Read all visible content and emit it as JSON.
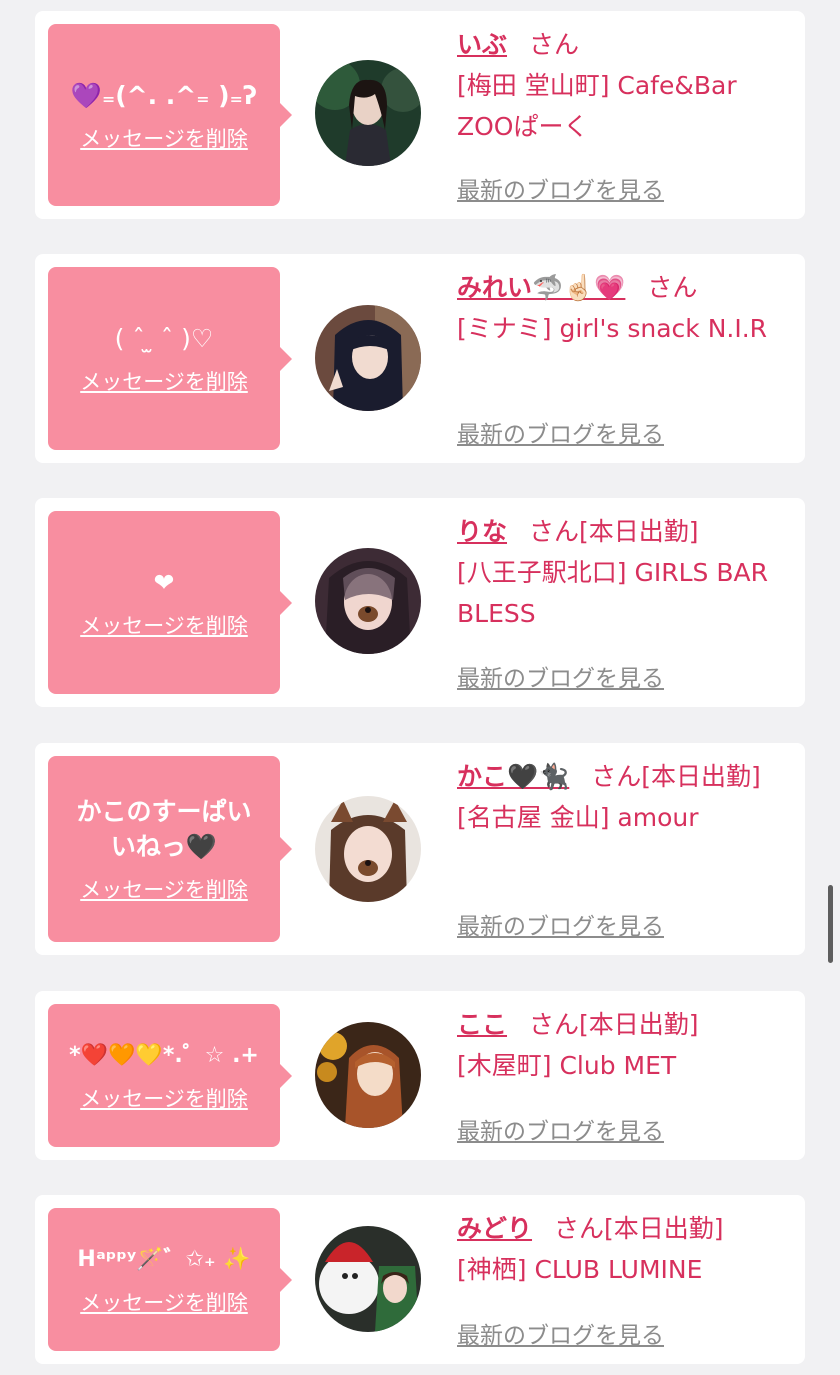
{
  "theme": {
    "bubble_color": "#f88ea0",
    "accent": "#d7305d",
    "link_gray": "#8c8c8c"
  },
  "cards": [
    {
      "message": "💜₌(^. .^₌ )₌ʔ",
      "delete_label": "メッセージを削除",
      "name": "いぶ",
      "suffix": "さん",
      "shop": "[梅田 堂山町] Cafe&Bar ZOOぱーく",
      "blog_label": "最新のブログを見る",
      "avatar_icon": "profile-photo"
    },
    {
      "message": "( ˆ ̫ ˆ )♡",
      "delete_label": "メッセージを削除",
      "name": "みれい🦈☝🏻💗",
      "suffix": "さん",
      "shop": "[ミナミ] girl's snack N.I.R",
      "blog_label": "最新のブログを見る",
      "avatar_icon": "profile-photo"
    },
    {
      "message": "❤",
      "delete_label": "メッセージを削除",
      "name": "りな",
      "suffix": "さん[本日出勤]",
      "shop": "[八王子駅北口] GIRLS BAR BLESS",
      "blog_label": "最新のブログを見る",
      "avatar_icon": "profile-photo"
    },
    {
      "message": "かこのすーぱいいねっ🖤",
      "delete_label": "メッセージを削除",
      "name": "かこ🖤🐈‍⬛",
      "suffix": "さん[本日出勤]",
      "shop": "[名古屋 金山] amour",
      "blog_label": "最新のブログを見る",
      "avatar_icon": "profile-photo"
    },
    {
      "message": "*❤️🧡💛*.゜☆ .+",
      "delete_label": "メッセージを削除",
      "name": "ここ",
      "suffix": "さん[本日出勤]",
      "shop": "[木屋町] Club MET",
      "blog_label": "最新のブログを見る",
      "avatar_icon": "profile-photo"
    },
    {
      "message": "Hᵃᵖᵖʸ🪄゛✩₊ ✨",
      "delete_label": "メッセージを削除",
      "name": "みどり",
      "suffix": "さん[本日出勤]",
      "shop": "[神栖] CLUB LUMINE",
      "blog_label": "最新のブログを見る",
      "avatar_icon": "profile-photo"
    }
  ]
}
